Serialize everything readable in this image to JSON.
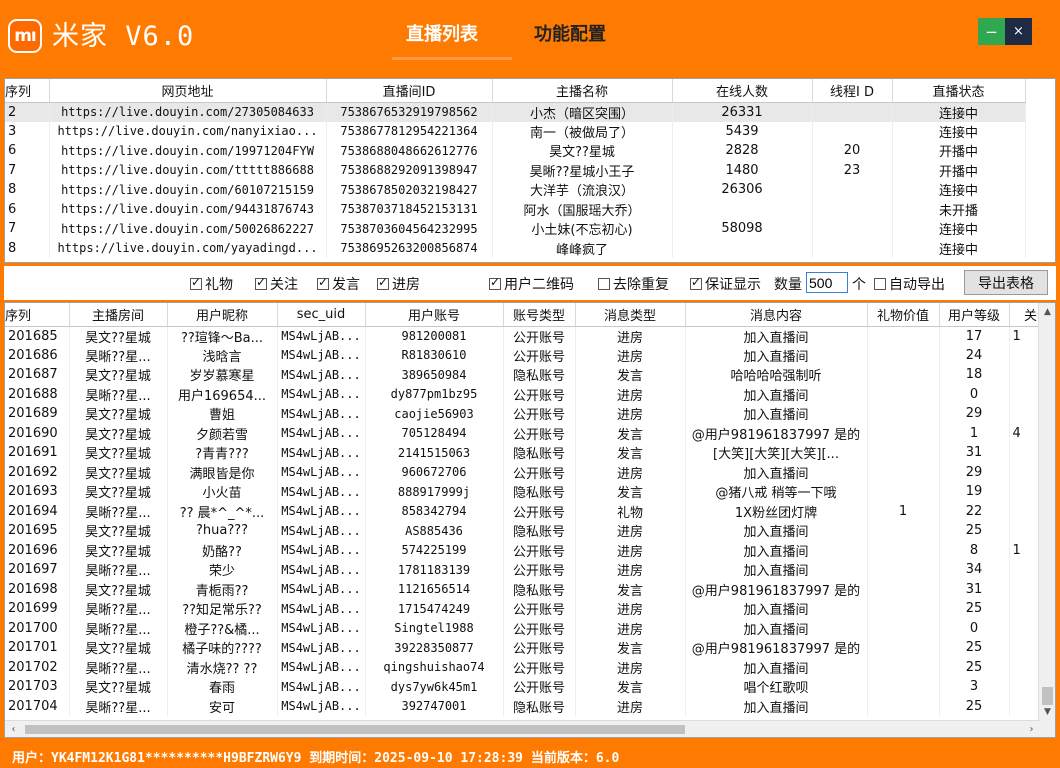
{
  "header": {
    "logo_text": "mı",
    "app_title": "米家 V6.0",
    "tabs": [
      {
        "label": "直播列表"
      },
      {
        "label": "功能配置"
      }
    ],
    "minimize_symbol": "−",
    "close_symbol": "×"
  },
  "room_table": {
    "columns": [
      "序列",
      "网页地址",
      "直播间ID",
      "主播名称",
      "在线人数",
      "线程I D",
      "直播状态"
    ],
    "rows": [
      [
        "2",
        "https://live.douyin.com/27305084633",
        "7538676532919798562",
        "小杰（暗区突围）",
        "26331",
        "",
        "连接中"
      ],
      [
        "3",
        "https://live.douyin.com/nanyixiao...",
        "7538677812954221364",
        "南一（被做局了）",
        "5439",
        "",
        "连接中"
      ],
      [
        "6",
        "https://live.douyin.com/19971204FYW",
        "7538688048662612776",
        "昊文??星城",
        "2828",
        "20",
        "开播中"
      ],
      [
        "7",
        "https://live.douyin.com/ttttt886688",
        "7538688292091398947",
        "昊晰??星城小王子",
        "1480",
        "23",
        "开播中"
      ],
      [
        "8",
        "https://live.douyin.com/60107215159",
        "7538678502032198427",
        "大洋芋（流浪汉）",
        "26306",
        "",
        "连接中"
      ],
      [
        "6",
        "https://live.douyin.com/94431876743",
        "7538703718452153131",
        "阿水（国服瑶大乔）",
        "",
        "",
        "未开播"
      ],
      [
        "7",
        "https://live.douyin.com/50026862227",
        "7538703604564232995",
        "小土妹(不忘初心)",
        "58098",
        "",
        "连接中"
      ],
      [
        "8",
        "https://live.douyin.com/yayadingd...",
        "7538695263200856874",
        "峰峰疯了",
        "",
        "",
        "连接中"
      ]
    ]
  },
  "options": {
    "gift": "礼物",
    "follow": "关注",
    "speak": "发言",
    "enter": "进房",
    "qr": "用户二维码",
    "dedupe": "去除重复",
    "ensure": "保证显示",
    "qty_label": "数量",
    "qty_value": "500",
    "qty_unit": "个",
    "auto_export": "自动导出",
    "export_button": "导出表格"
  },
  "message_table": {
    "columns": [
      "序列",
      "主播房间",
      "用户昵称",
      "sec_uid",
      "用户账号",
      "账号类型",
      "消息类型",
      "消息内容",
      "礼物价值",
      "用户等级",
      "关注"
    ],
    "rows": [
      [
        "201685",
        "昊文??星城",
        "??瑄锋～Ba...",
        "MS4wLjAB...",
        "981200081",
        "公开账号",
        "进房",
        "加入直播间",
        "",
        "17",
        "1"
      ],
      [
        "201686",
        "昊晰??星...",
        "浅晗言",
        "MS4wLjAB...",
        "R81830610",
        "公开账号",
        "进房",
        "加入直播间",
        "",
        "24",
        ""
      ],
      [
        "201687",
        "昊文??星城",
        "岁岁慕寒星",
        "MS4wLjAB...",
        "389650984",
        "隐私账号",
        "发言",
        "哈哈哈哈强制听",
        "",
        "18",
        ""
      ],
      [
        "201688",
        "昊晰??星...",
        "用户169654...",
        "MS4wLjAB...",
        "dy877pm1bz95",
        "公开账号",
        "进房",
        "加入直播间",
        "",
        "0",
        ""
      ],
      [
        "201689",
        "昊文??星城",
        "曹姐",
        "MS4wLjAB...",
        "caojie56903",
        "公开账号",
        "进房",
        "加入直播间",
        "",
        "29",
        ""
      ],
      [
        "201690",
        "昊文??星城",
        "夕颜若雪",
        "MS4wLjAB...",
        "705128494",
        "公开账号",
        "发言",
        "@用户981961837997 是的",
        "",
        "1",
        "4"
      ],
      [
        "201691",
        "昊文??星城",
        "?青青???",
        "MS4wLjAB...",
        "2141515063",
        "隐私账号",
        "发言",
        "[大笑][大笑][大笑][...",
        "",
        "31",
        ""
      ],
      [
        "201692",
        "昊文??星城",
        "满眼皆是你",
        "MS4wLjAB...",
        "960672706",
        "公开账号",
        "进房",
        "加入直播间",
        "",
        "29",
        ""
      ],
      [
        "201693",
        "昊文??星城",
        "小火苗",
        "MS4wLjAB...",
        "888917999j",
        "隐私账号",
        "发言",
        "@猪八戒 稍等一下哦",
        "",
        "19",
        ""
      ],
      [
        "201694",
        "昊晰??星...",
        "?? 晨*^_^*...",
        "MS4wLjAB...",
        "858342794",
        "公开账号",
        "礼物",
        "1X粉丝团灯牌",
        "1",
        "22",
        ""
      ],
      [
        "201695",
        "昊文??星城",
        "?hua???",
        "MS4wLjAB...",
        "AS885436",
        "隐私账号",
        "进房",
        "加入直播间",
        "",
        "25",
        ""
      ],
      [
        "201696",
        "昊文??星城",
        "奶酪??",
        "MS4wLjAB...",
        "574225199",
        "公开账号",
        "进房",
        "加入直播间",
        "",
        "8",
        "1"
      ],
      [
        "201697",
        "昊晰??星...",
        "荣少",
        "MS4wLjAB...",
        "1781183139",
        "公开账号",
        "进房",
        "加入直播间",
        "",
        "34",
        ""
      ],
      [
        "201698",
        "昊文??星城",
        "青栀雨??",
        "MS4wLjAB...",
        "1121656514",
        "隐私账号",
        "发言",
        "@用户981961837997 是的",
        "",
        "31",
        ""
      ],
      [
        "201699",
        "昊晰??星...",
        "??知足常乐??",
        "MS4wLjAB...",
        "1715474249",
        "公开账号",
        "进房",
        "加入直播间",
        "",
        "25",
        ""
      ],
      [
        "201700",
        "昊晰??星...",
        "橙子??&橘...",
        "MS4wLjAB...",
        "Singtel1988",
        "公开账号",
        "进房",
        "加入直播间",
        "",
        "0",
        ""
      ],
      [
        "201701",
        "昊文??星城",
        "橘子味的????",
        "MS4wLjAB...",
        "39228350877",
        "公开账号",
        "发言",
        "@用户981961837997 是的",
        "",
        "25",
        ""
      ],
      [
        "201702",
        "昊晰??星...",
        "清水烧?? ??",
        "MS4wLjAB...",
        "qingshuishao74",
        "公开账号",
        "进房",
        "加入直播间",
        "",
        "25",
        ""
      ],
      [
        "201703",
        "昊文??星城",
        "春雨",
        "MS4wLjAB...",
        "dys7yw6k45m1",
        "公开账号",
        "发言",
        "唱个红歌呗",
        "",
        "3",
        ""
      ],
      [
        "201704",
        "昊晰??星...",
        "安可",
        "MS4wLjAB...",
        "392747001",
        "隐私账号",
        "进房",
        "加入直播间",
        "",
        "25",
        ""
      ]
    ]
  },
  "status_bar": {
    "text": "用户：YK4FM12K1G81**********H9BFZRW6Y9 到期时间：2025-09-10 17:28:39 当前版本：6.0"
  }
}
